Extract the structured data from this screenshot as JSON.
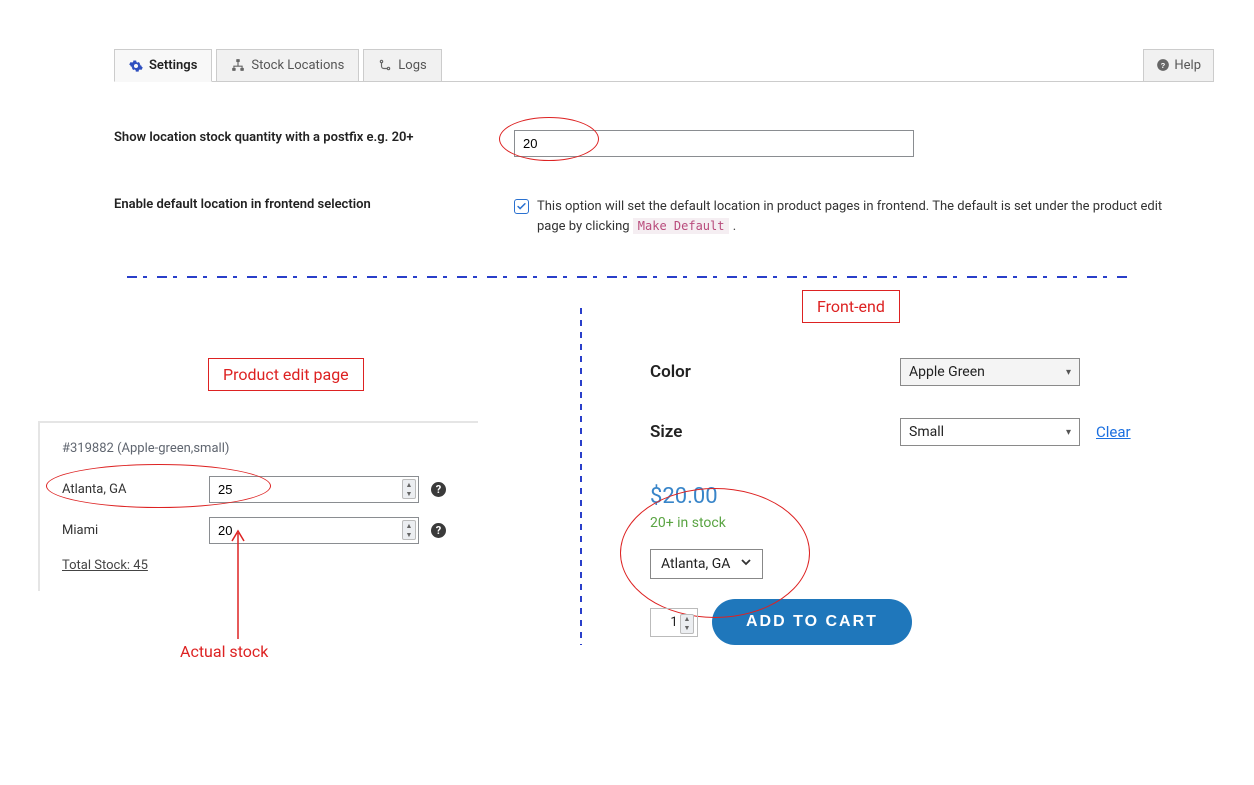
{
  "tabs": {
    "settings": "Settings",
    "stock_locations": "Stock Locations",
    "logs": "Logs",
    "help": "Help"
  },
  "settings": {
    "postfix_label": "Show location stock quantity with a postfix e.g. 20+",
    "postfix_value": "20",
    "default_loc_label": "Enable default location in frontend selection",
    "default_loc_desc_a": "This option will set the default location in product pages in frontend. The default is set under the product edit page by clicking ",
    "default_loc_code": "Make Default",
    "default_loc_desc_b": "."
  },
  "annotations": {
    "frontend": "Front-end",
    "editpage": "Product edit page",
    "actual_stock": "Actual stock"
  },
  "product_edit": {
    "header": "#319882 (Apple-green,small)",
    "locations": [
      {
        "name": "Atlanta, GA",
        "qty": "25"
      },
      {
        "name": "Miami",
        "qty": "20"
      }
    ],
    "total_stock": "Total Stock: 45"
  },
  "frontend": {
    "color_label": "Color",
    "color_value": "Apple Green",
    "size_label": "Size",
    "size_value": "Small",
    "clear": "Clear",
    "price": "$20.00",
    "stock_msg": "20+ in stock",
    "location_value": "Atlanta, GA",
    "qty": "1",
    "add_to_cart": "ADD TO CART"
  }
}
